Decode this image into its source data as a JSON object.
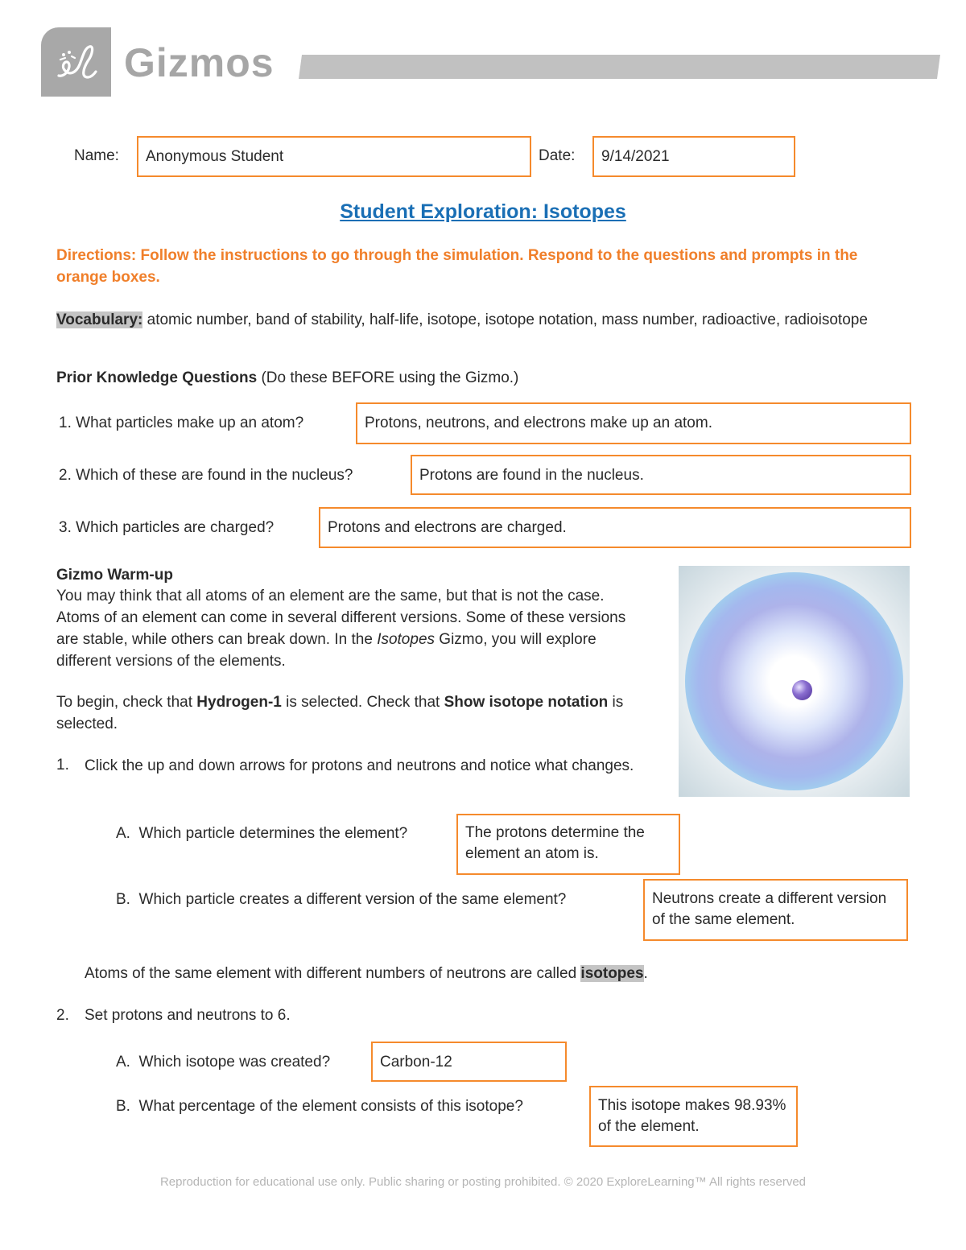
{
  "header": {
    "logo_mark": "el",
    "brand": "Gizmos"
  },
  "student": {
    "name_label": "Name:",
    "name_value": "Anonymous Student",
    "date_label": "Date:",
    "date_value": "9/14/2021"
  },
  "title": "Student Exploration: Isotopes",
  "directions": "Directions: Follow the instructions to go through the simulation. Respond to the questions and prompts in the orange boxes.",
  "vocabulary": {
    "label": "Vocabulary:",
    "terms": "atomic number, band of stability, half-life, isotope, isotope notation, mass number, radioactive, radioisotope"
  },
  "prior_knowledge": {
    "heading": "Prior Knowledge Questions",
    "note": "(Do these BEFORE using the Gizmo.)",
    "questions": [
      {
        "number": "1.",
        "question": "What particles make up an atom?",
        "answer": "Protons, neutrons, and electrons make up an atom."
      },
      {
        "number": "2.",
        "question": "Which of these are found in the nucleus?",
        "answer": "Protons are found in the nucleus."
      },
      {
        "number": "3.",
        "question": "Which particles are charged?",
        "answer": "Protons and electrons are charged."
      }
    ]
  },
  "warmup": {
    "heading": "Gizmo Warm-up",
    "para1_a": "You may think that all atoms of an element are the same, but that is not the case. Atoms of an element can come in several different versions. Some of these versions are stable, while others can break down. In the ",
    "para1_italic": "Isotopes",
    "para1_b": " Gizmo, you will explore different versions of the elements.",
    "para2_a": "To begin, check that ",
    "para2_bold1": "Hydrogen-1",
    "para2_b": " is selected. Check that ",
    "para2_bold2": "Show isotope notation",
    "para2_c": " is selected.",
    "image_alt": "Hydrogen atom with electron cloud",
    "q1": {
      "number": "1.",
      "text": "Click the up and down arrows for protons and neutrons and notice what changes.",
      "parts": [
        {
          "letter": "A.",
          "question": "Which particle determines the element?",
          "answer": "The protons determine the element an atom is."
        },
        {
          "letter": "B.",
          "question": "Which particle creates a different version of the same element?",
          "answer": "Neutrons create a different version of the same element."
        }
      ]
    },
    "isotopes_note_a": "Atoms of the same element with different numbers of neutrons are called ",
    "isotopes_note_term": "isotopes",
    "isotopes_note_b": ".",
    "q2": {
      "number": "2.",
      "text": "Set protons and neutrons to 6.",
      "parts": [
        {
          "letter": "A.",
          "question": "Which isotope was created?",
          "answer": "Carbon-12"
        },
        {
          "letter": "B.",
          "question": "What percentage of the element consists of this isotope?",
          "answer": "This isotope makes 98.93% of the element."
        }
      ]
    }
  },
  "footer": "Reproduction for educational use only. Public sharing or posting prohibited. © 2020 ExploreLearning™ All rights reserved",
  "colors": {
    "answer_border": "#f58a2c",
    "directions": "#f07f2a",
    "title": "#1a6fb5",
    "logo_gray": "#a8a8a8"
  }
}
